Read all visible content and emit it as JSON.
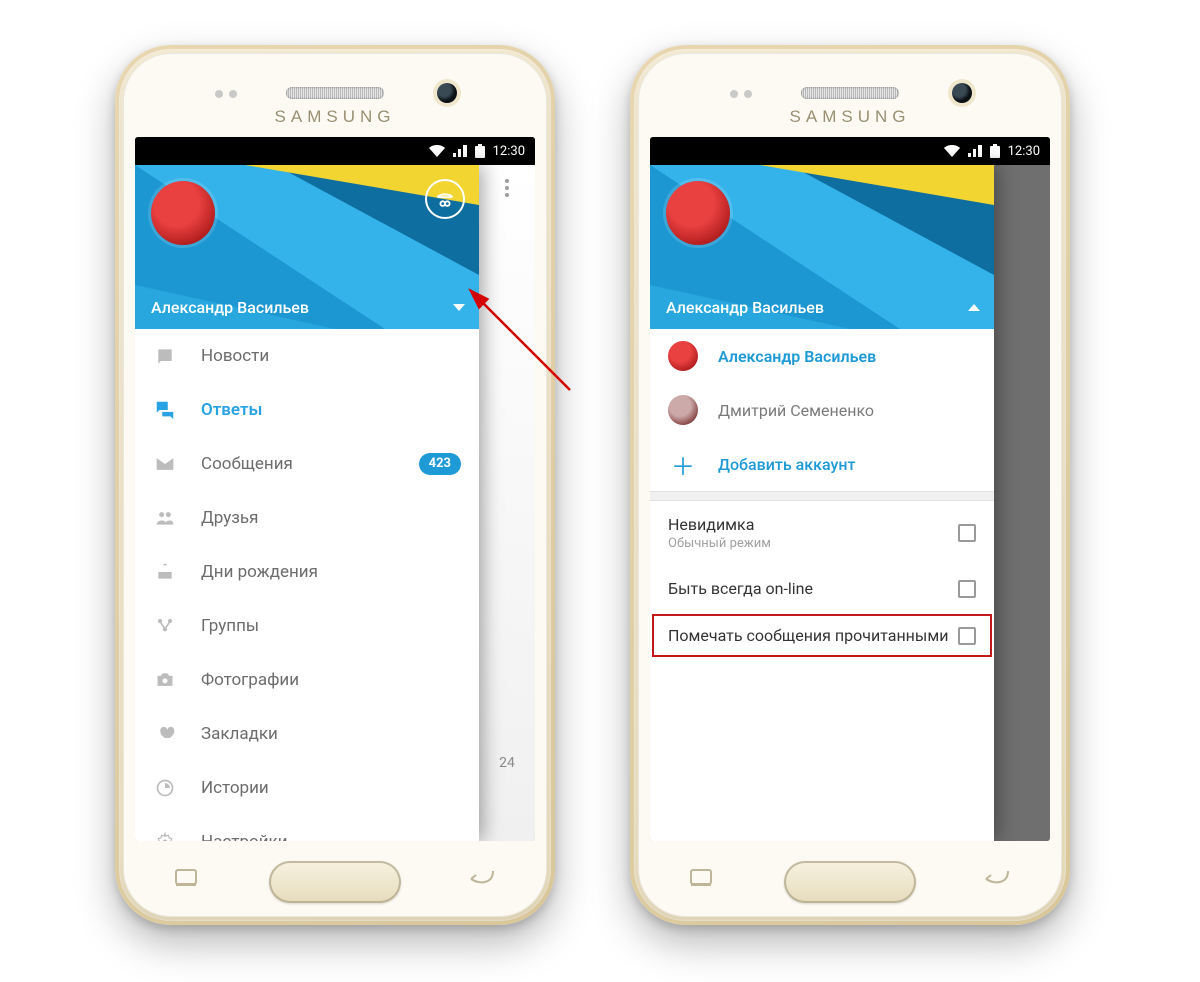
{
  "brand": "SAMSUNG",
  "status_time": "12:30",
  "user_name": "Александр Васильев",
  "phone1": {
    "nav": [
      {
        "icon": "news-icon",
        "label": "Новости",
        "badge": null,
        "active": false
      },
      {
        "icon": "replies-icon",
        "label": "Ответы",
        "badge": null,
        "active": true
      },
      {
        "icon": "mail-icon",
        "label": "Сообщения",
        "badge": "423",
        "active": false
      },
      {
        "icon": "friends-icon",
        "label": "Друзья",
        "badge": null,
        "active": false
      },
      {
        "icon": "birthday-icon",
        "label": "Дни рождения",
        "badge": null,
        "active": false
      },
      {
        "icon": "groups-icon",
        "label": "Группы",
        "badge": null,
        "active": false
      },
      {
        "icon": "photo-icon",
        "label": "Фотографии",
        "badge": null,
        "active": false
      },
      {
        "icon": "bookmarks-icon",
        "label": "Закладки",
        "badge": null,
        "active": false
      },
      {
        "icon": "stories-icon",
        "label": "Истории",
        "badge": null,
        "active": false
      },
      {
        "icon": "settings-icon",
        "label": "Настройки",
        "badge": null,
        "active": false
      }
    ],
    "peek_count": "24"
  },
  "phone2": {
    "accounts": [
      {
        "name": "Александр Васильев",
        "active": true
      },
      {
        "name": "Дмитрий Семененко",
        "active": false
      }
    ],
    "add_account": "Добавить аккаунт",
    "options": [
      {
        "title": "Невидимка",
        "sub": "Обычный режим",
        "checked": false,
        "highlight": false
      },
      {
        "title": "Быть всегда on-line",
        "sub": null,
        "checked": false,
        "highlight": false
      },
      {
        "title": "Помечать сообщения прочитанными",
        "sub": null,
        "checked": false,
        "highlight": true
      }
    ]
  }
}
